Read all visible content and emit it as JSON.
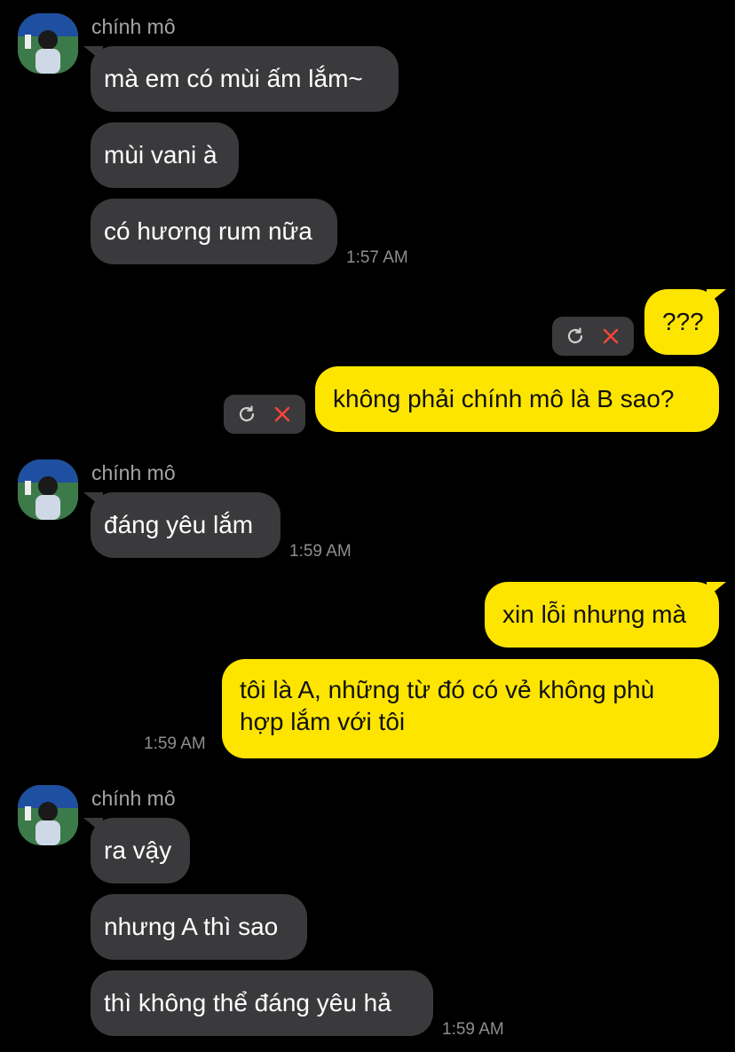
{
  "contact": {
    "name": "chính mô"
  },
  "groups": [
    {
      "sender": "chính mô",
      "messages": [
        "mà em có mùi ấm lắm~",
        "mùi vani à",
        "có hương rum nữa"
      ],
      "time": "1:57 AM"
    },
    {
      "outgoing_failed": [
        "???",
        "không phải chính mô là B sao?"
      ]
    },
    {
      "sender": "chính mô",
      "messages": [
        "đáng yêu lắm"
      ],
      "time": "1:59 AM"
    },
    {
      "outgoing": [
        "xin lỗi nhưng mà",
        "tôi là A, những từ đó có vẻ không phù hợp lắm với tôi"
      ],
      "time": "1:59 AM"
    },
    {
      "sender": "chính mô",
      "messages": [
        "ra vậy",
        "nhưng A thì sao",
        "thì không thể đáng yêu hả"
      ],
      "time": "1:59 AM"
    }
  ],
  "colors": {
    "background": "#000000",
    "incoming_bubble": "#3a3a3c",
    "outgoing_bubble": "#fde500",
    "fail_icon": "#ff453a",
    "timestamp": "#8e8e8e"
  },
  "icons": {
    "retry": "retry-icon",
    "delete": "delete-x-icon"
  }
}
